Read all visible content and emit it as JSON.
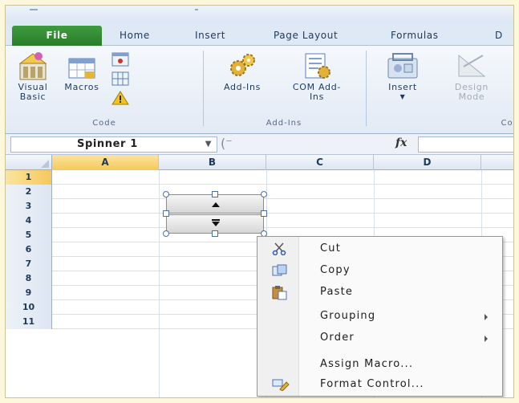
{
  "ribbon": {
    "tabs": [
      "File",
      "Home",
      "Insert",
      "Page Layout",
      "Formulas",
      "D"
    ],
    "code_group": {
      "label": "Code",
      "visual_basic": "Visual Basic",
      "macros": "Macros"
    },
    "addins_group": {
      "label": "Add-Ins",
      "add_ins": "Add-Ins",
      "com_add_ins": "COM Add-Ins"
    },
    "controls_group": {
      "label": "Con",
      "insert": "Insert",
      "design_mode": "Design Mode"
    }
  },
  "formula_bar": {
    "name_box": "Spinner 1",
    "fx_label": "fx",
    "formula": ""
  },
  "grid": {
    "columns": [
      "A",
      "B",
      "C",
      "D"
    ],
    "rows": [
      "1",
      "2",
      "3",
      "4",
      "5",
      "6",
      "7",
      "8",
      "9",
      "10",
      "11"
    ],
    "selected_column": "A",
    "selected_row": "1"
  },
  "context_menu": {
    "items": [
      {
        "label": "Cut",
        "icon": "scissors-icon"
      },
      {
        "label": "Copy",
        "icon": "copy-icon"
      },
      {
        "label": "Paste",
        "icon": "paste-icon"
      },
      {
        "label": "Grouping",
        "submenu": true
      },
      {
        "label": "Order",
        "submenu": true
      },
      {
        "label": "Assign Macro..."
      },
      {
        "label": "Format Control...",
        "icon": "format-control-icon"
      }
    ]
  },
  "colors": {
    "file_tab": "#2a7d2a",
    "selected_header": "#f6c85c",
    "background": "#fdf8dc"
  }
}
